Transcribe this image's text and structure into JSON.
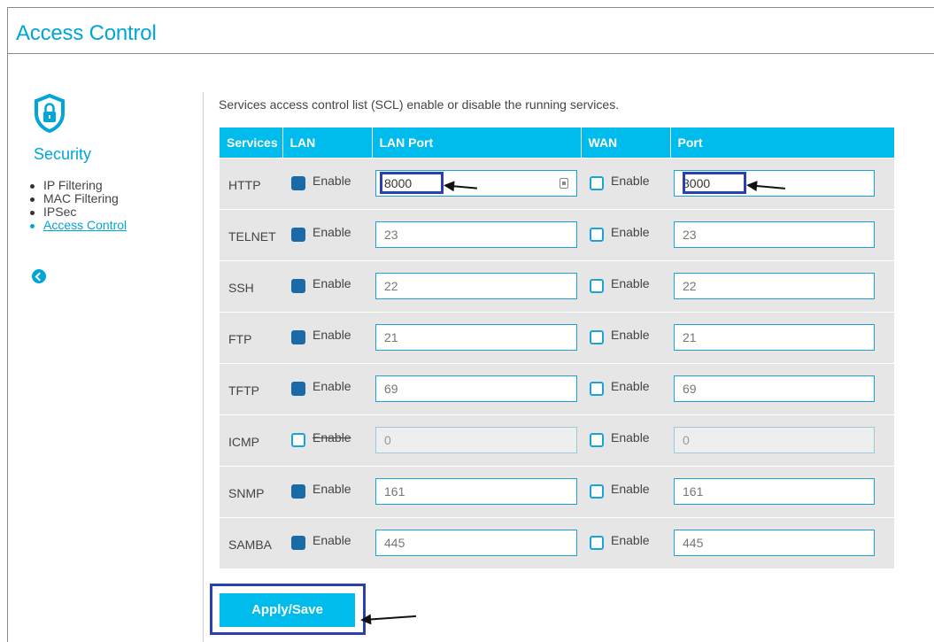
{
  "page": {
    "title": "Access Control"
  },
  "sidebar": {
    "heading": "Security",
    "items": [
      {
        "label": "IP Filtering",
        "active": false
      },
      {
        "label": "MAC Filtering",
        "active": false
      },
      {
        "label": "IPSec",
        "active": false
      },
      {
        "label": "Access Control",
        "active": true
      }
    ]
  },
  "main": {
    "intro": "Services access control list (SCL) enable or disable the running services.",
    "columns": [
      "Services",
      "LAN",
      "LAN Port",
      "WAN",
      "Port"
    ],
    "checkbox_label": "Enable",
    "rows": [
      {
        "service": "HTTP",
        "lan_enabled": true,
        "lan_port": "8000",
        "wan_enabled": false,
        "wan_port": "8000"
      },
      {
        "service": "TELNET",
        "lan_enabled": true,
        "lan_port": "23",
        "wan_enabled": false,
        "wan_port": "23"
      },
      {
        "service": "SSH",
        "lan_enabled": true,
        "lan_port": "22",
        "wan_enabled": false,
        "wan_port": "22"
      },
      {
        "service": "FTP",
        "lan_enabled": true,
        "lan_port": "21",
        "wan_enabled": false,
        "wan_port": "21"
      },
      {
        "service": "TFTP",
        "lan_enabled": true,
        "lan_port": "69",
        "wan_enabled": false,
        "wan_port": "69"
      },
      {
        "service": "ICMP",
        "lan_enabled": false,
        "lan_port": "0",
        "wan_enabled": false,
        "wan_port": "0"
      },
      {
        "service": "SNMP",
        "lan_enabled": true,
        "lan_port": "161",
        "wan_enabled": false,
        "wan_port": "161"
      },
      {
        "service": "SAMBA",
        "lan_enabled": true,
        "lan_port": "445",
        "wan_enabled": false,
        "wan_port": "445"
      }
    ],
    "apply_label": "Apply/Save"
  },
  "colors": {
    "accent": "#00bcec",
    "title": "#00a6d6",
    "checked": "#1b6aa8",
    "highlight": "#2c3fb0"
  }
}
